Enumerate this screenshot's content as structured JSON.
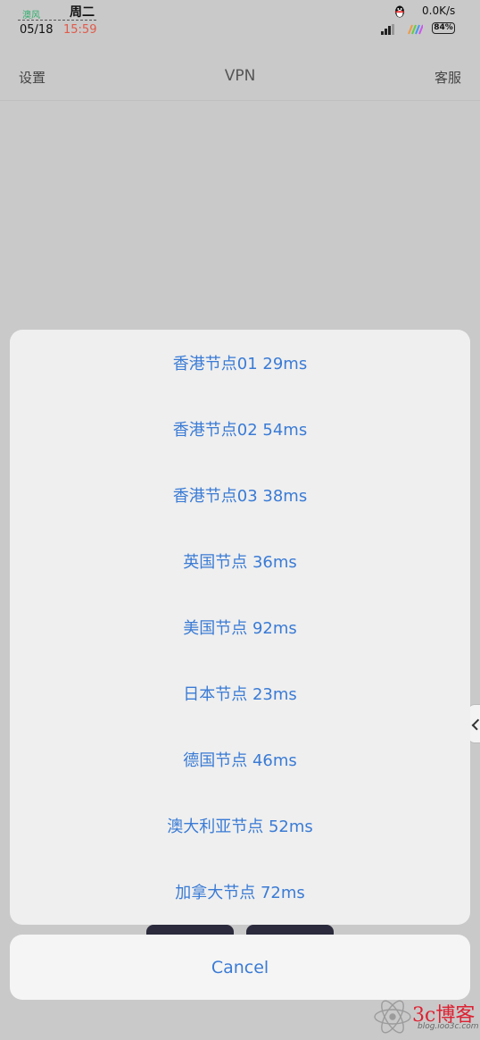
{
  "status_bar": {
    "weather_logo": "澳风",
    "weekday": "周二",
    "date": "05/18",
    "time": "15:59",
    "net_speed": "0.0K/s",
    "battery": "84%"
  },
  "nav": {
    "left": "设置",
    "title": "VPN",
    "right": "客服"
  },
  "sheet": {
    "items": [
      "香港节点01 29ms",
      "香港节点02 54ms",
      "香港节点03 38ms",
      "英国节点 36ms",
      "美国节点 92ms",
      "日本节点 23ms",
      "德国节点 46ms",
      "澳大利亚节点 52ms",
      "加拿大节点 72ms"
    ],
    "cancel": "Cancel"
  },
  "watermark": {
    "brand": "3c博客",
    "url": "blog.ioo3c.com"
  },
  "colors": {
    "accent": "#3a7bd5",
    "overlay": "#c9c9c9",
    "sheet": "#efefef"
  }
}
